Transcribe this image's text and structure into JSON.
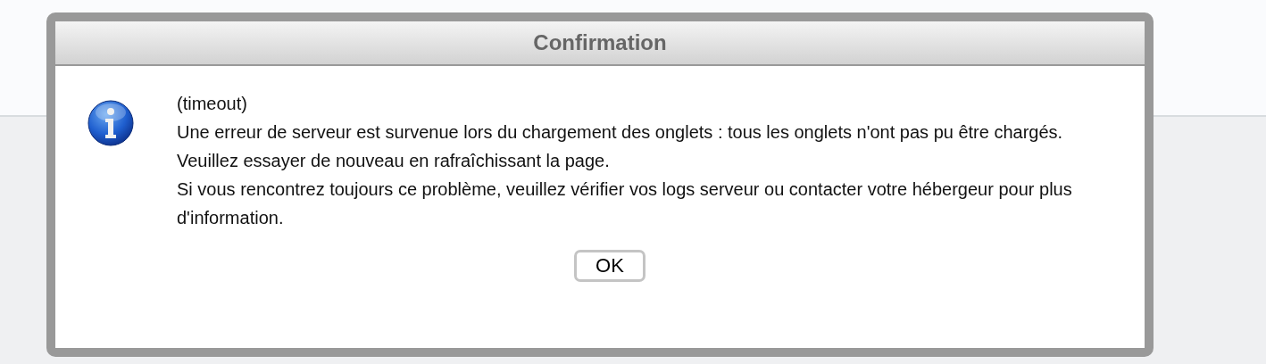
{
  "dialog": {
    "title": "Confirmation",
    "message_lines": [
      "(timeout)",
      "Une erreur de serveur est survenue lors du chargement des onglets : tous les onglets n'ont pas pu être chargés.",
      "Veuillez essayer de nouveau en rafraîchissant la page.",
      "Si vous rencontrez toujours ce problème, veuillez vérifier vos logs serveur ou contacter votre hébergeur pour plus d'information."
    ],
    "buttons": [
      "OK"
    ]
  }
}
